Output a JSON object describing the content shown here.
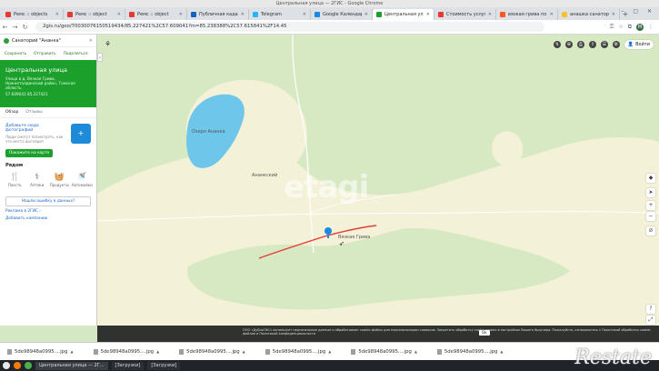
{
  "window": {
    "title": "Центральная улица — 2ГИС - Google Chrome",
    "controls": "– ▢ ✕"
  },
  "tabs": [
    {
      "label": "Ремс :: objects",
      "color": "#e53935"
    },
    {
      "label": "Ремс :: object",
      "color": "#e53935"
    },
    {
      "label": "Ремс :: object",
      "color": "#e53935"
    },
    {
      "label": "Публичная кадас",
      "color": "#1565c0"
    },
    {
      "label": "Telegram",
      "color": "#29b6f6"
    },
    {
      "label": "Google Календар",
      "color": "#1e88e5"
    },
    {
      "label": "Центральная улиц",
      "color": "#1ba12b",
      "active": true
    },
    {
      "label": "Стоимость услуг",
      "color": "#e53935"
    },
    {
      "label": "вязкая грива по",
      "color": "#ff5722"
    },
    {
      "label": "анашка санаторий",
      "color": "#fbc02d"
    }
  ],
  "address_bar": {
    "url": "2gis.ru/geo/70030076150519434/85.227421%2C57.609041?m=85.238388%2C57.615841%2F14.45",
    "profile_letter": "M"
  },
  "sidebar": {
    "search_value": "Санаторий \"Ананка\"",
    "actions": [
      "Сохранить",
      "Отправить",
      "Поделиться"
    ],
    "place": {
      "title": "Центральная улица",
      "address": "Улица в д. Вязкая Грива, Нижнеталдинский район, Томская область",
      "coords": "57.609041 85.227421"
    },
    "subtabs": [
      "Обзор",
      "Отзывы"
    ],
    "photo": {
      "link": "Добавьте сюда фотографий",
      "desc": "Люди смогут посмотреть, как это место выглядит",
      "icon": "+"
    },
    "show_on_map": "Покажите на карте",
    "nearby_title": "Рядом",
    "nearby": [
      {
        "label": "Поесть",
        "icon": "🍴"
      },
      {
        "label": "Аптеки",
        "icon": "⚕"
      },
      {
        "label": "Продукты",
        "icon": "🧺"
      },
      {
        "label": "Автомойки",
        "icon": "🚿"
      }
    ],
    "report": "Нашли ошибку в данных?",
    "links": [
      "Реклама в 2ГИС ›",
      "Добавить компанию"
    ]
  },
  "map": {
    "labels": {
      "lake": "Озеро Ананка",
      "village_north": "Ананкский",
      "village_south": "Вязкая Грива"
    },
    "watermark": "etagi",
    "login": "Войти",
    "controls": [
      "◆",
      "➤",
      "+",
      "−",
      "⊘"
    ]
  },
  "cookie": {
    "text": "ООО «ДубльГИС» использует персональные данные и обрабатывает cookie-файлы для персонализации сервисов. Запретить обработку cookie можно в настройках Вашего браузера. Пожалуйста, ознакомьтесь с Политикой обработки cookie-файлов и Политикой конфиденциальности",
    "ok": "Ок"
  },
  "downloads": [
    "5de98948a0995....jpg",
    "5de98948a0995....jpg",
    "5de98948a0995....jpg",
    "5de98948a0995....jpg",
    "5de98948a0995....jpg",
    "5de98948a0995....jpg"
  ],
  "taskbar": {
    "tasks": [
      "Центральная улица — 2Г...",
      "[Загрузки]",
      "[Загрузки]"
    ],
    "brand": "Restate"
  }
}
